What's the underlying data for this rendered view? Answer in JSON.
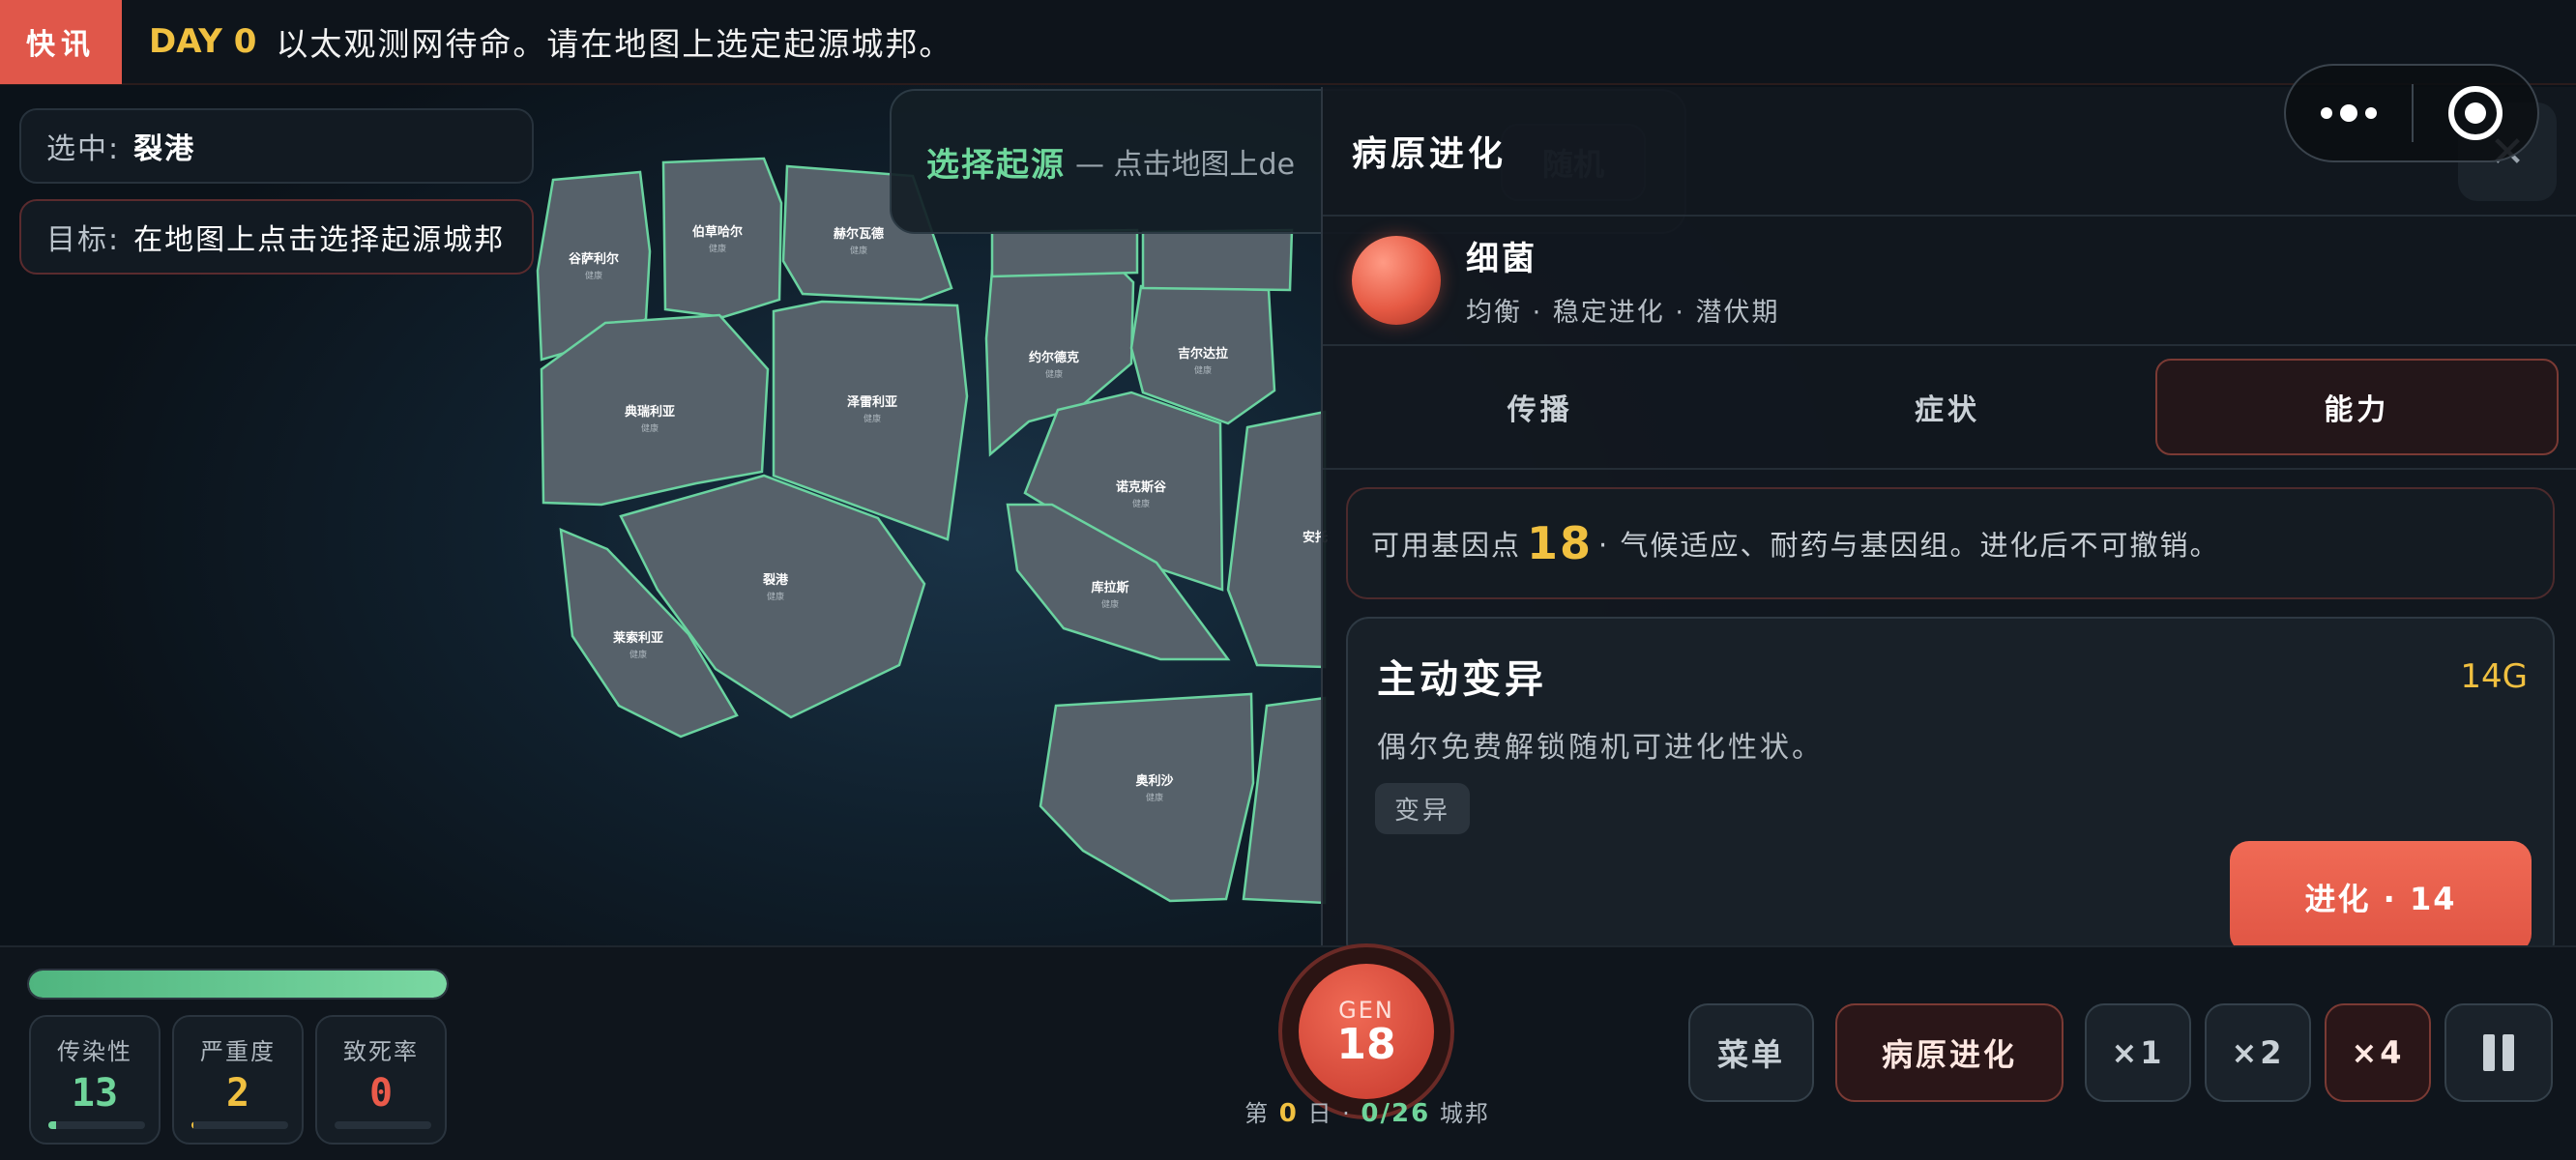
{
  "news": {
    "tag": "快讯",
    "day": "DAY 0",
    "text": "以太观测网待命。请在地图上选定起源城邦。"
  },
  "selected": {
    "label": "选中:",
    "value": "裂港"
  },
  "target": {
    "label": "目标:",
    "value": "在地图上点击选择起源城邦"
  },
  "origin": {
    "title": "选择起源",
    "subtitle": "— 点击地图上de",
    "random_label": "随机"
  },
  "map": {
    "regions": [
      {
        "name": "谷萨利尔",
        "status": "健康"
      },
      {
        "name": "伯草哈尔",
        "status": "健康"
      },
      {
        "name": "赫尔瓦德",
        "status": "健康"
      },
      {
        "name": "典瑞利亚",
        "status": "健康"
      },
      {
        "name": "泽雷利亚",
        "status": "健康"
      },
      {
        "name": "裂港",
        "status": "健康"
      },
      {
        "name": "莱索利亚",
        "status": "健康"
      },
      {
        "name": "约尔德克",
        "status": "健康"
      },
      {
        "name": "吉尔达拉",
        "status": "健康"
      },
      {
        "name": "诺克斯谷",
        "status": "健康"
      },
      {
        "name": "库拉斯",
        "status": "健康"
      },
      {
        "name": "安托",
        "status": ""
      },
      {
        "name": "奥利沙",
        "status": "健康"
      }
    ]
  },
  "panel": {
    "title": "病原进化",
    "close_label": "✕",
    "pathogen": {
      "name": "细菌",
      "desc": "均衡 · 稳定进化 · 潜伏期"
    },
    "tabs": [
      {
        "label": "传播"
      },
      {
        "label": "症状"
      },
      {
        "label": "能力"
      }
    ],
    "active_tab": "能力",
    "gene": {
      "prefix": "可用基因点",
      "points": "18",
      "suffix": "· 气候适应、耐药与基因组。进化后不可撤销。"
    },
    "card": {
      "title": "主动变异",
      "cost": "14G",
      "desc": "偶尔免费解锁随机可进化性状。",
      "tag": "变异",
      "button": "进化 · 14"
    }
  },
  "hud": {
    "progress": 1.0,
    "stats": [
      {
        "label": "传染性",
        "value": "13",
        "color": "#6fd49a",
        "fill": 0.08
      },
      {
        "label": "严重度",
        "value": "2",
        "color": "#f0c040",
        "fill": 0.02
      },
      {
        "label": "致死率",
        "value": "0",
        "color": "#ea5a4a",
        "fill": 0.0
      }
    ],
    "gen": {
      "label": "GEN",
      "value": "18"
    },
    "day": {
      "pre": "第",
      "num": "0",
      "mid": "日 ·",
      "count": "0/26",
      "post": "城邦"
    },
    "buttons": {
      "menu": "菜单",
      "evolve": "病原进化",
      "x1": "×1",
      "x2": "×2",
      "x4": "×4"
    }
  },
  "colors": {
    "accent_red": "#e0574a",
    "gold": "#f0c040",
    "green": "#6fd49a"
  },
  "icons": {
    "menu": "more-dots-icon",
    "target": "target-icon",
    "pause": "pause-icon"
  }
}
